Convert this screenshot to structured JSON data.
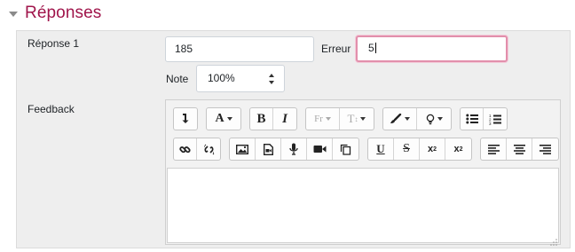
{
  "section": {
    "title": "Réponses",
    "accent_color": "#a0154b"
  },
  "answer": {
    "label": "Réponse 1",
    "value": "185",
    "error_label": "Erreur",
    "error_value": "5",
    "grade_label": "Note",
    "grade_value": "100%",
    "feedback_label": "Feedback"
  },
  "editor": {
    "toolbar_rows": [
      [
        [
          "undo-arrow-icon"
        ],
        [
          "font-color-icon"
        ],
        [
          "bold-icon",
          "italic-icon"
        ],
        [
          "font-family-icon",
          "font-size-icon"
        ],
        [
          "highlight-brush-icon",
          "lightbulb-icon"
        ],
        [
          "bullet-list-icon",
          "numbered-list-icon"
        ]
      ],
      [
        [
          "link-icon",
          "unlink-icon"
        ],
        [
          "image-icon",
          "media-icon",
          "microphone-icon",
          "video-camera-icon",
          "copy-icon"
        ],
        [
          "underline-icon",
          "strikethrough-icon",
          "subscript-icon",
          "superscript-icon"
        ],
        [
          "align-left-icon",
          "align-center-icon",
          "align-right-icon"
        ]
      ]
    ],
    "button_text": {
      "font_color": "A",
      "bold": "B",
      "italic": "I",
      "font_family": "Fr",
      "font_size": "T",
      "underline": "U",
      "strikethrough": "S",
      "subscript": "x",
      "superscript": "x"
    },
    "content": ""
  }
}
